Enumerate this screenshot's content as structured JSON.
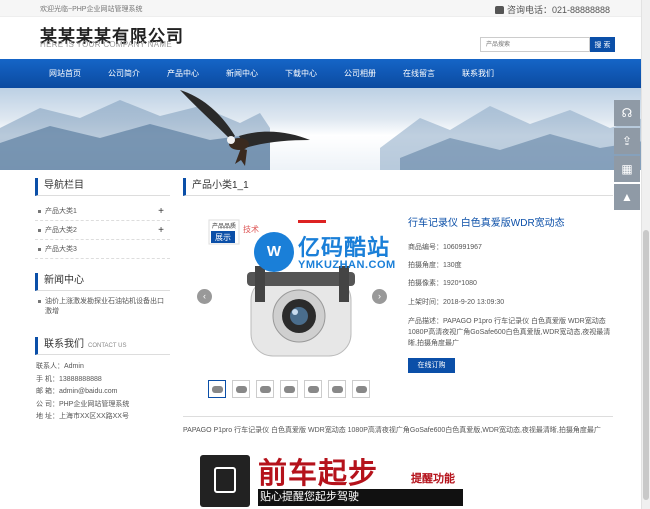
{
  "topbar": {
    "welcome": "欢迎光临~PHP企业网站管理系统",
    "phone": "咨询电话：021-88888888"
  },
  "header": {
    "company_cn": "某某某某有限公司",
    "company_en": "HERE IS YOUR COMPANY NAME",
    "search_placeholder": "产品搜索",
    "search_button": "搜 索"
  },
  "nav": {
    "items": [
      "网站首页",
      "公司简介",
      "产品中心",
      "新闻中心",
      "下载中心",
      "公司相册",
      "在线留言",
      "联系我们"
    ]
  },
  "sidebar": {
    "nav_title": "导航栏目",
    "categories": [
      {
        "label": "产品大类1",
        "expand": "+"
      },
      {
        "label": "产品大类2",
        "expand": "+"
      },
      {
        "label": "产品大类3",
        "expand": ""
      }
    ],
    "news_title": "新闻中心",
    "news": [
      "油价上涨激发勘探业石油钻机设备出口激增"
    ],
    "contact_title": "联系我们",
    "contact_sub": "CONTACT US",
    "contact": [
      "联系人：Admin",
      "手 机：13888888888",
      "邮 箱：admin@baidu.com",
      "公 司：PHP企业网站管理系统",
      "地 址：上海市XX区XX路XX号"
    ]
  },
  "main": {
    "title": "产品小类1_1",
    "product_title": "行车记录仪 白色真爱版WDR宽动态",
    "fields": [
      "商品编号：1060991967",
      "拍摄角度：130度",
      "拍摄像素：1920*1080",
      "上架时间：2018-9-20 13:09:30"
    ],
    "description": "产品描述：PAPAGO P1pro 行车记录仪 白色真爱版 WDR宽动态 1080P高清夜视广角GoSafe600白色真爱版,WDR宽动态,夜视最清晰,拍摄角度最广",
    "order_button": "在线订购",
    "detail": "PAPAGO P1pro 行车记录仪 白色真爱版 WDR宽动态 1080P高清夜视广角GoSafe600白色真爱版,WDR宽动态,夜视最清晰,拍摄角度最广",
    "gallery_prev": "‹",
    "gallery_next": "›",
    "image_labels": {
      "badge_top": "产品品质",
      "badge_main": "展示",
      "tech_mark": "技术"
    }
  },
  "watermark": {
    "cn": "亿码酷站",
    "en": "YMKUZHAN.COM"
  },
  "promo": {
    "headline": "前车起步",
    "sub": "提醒功能",
    "slogan": "贴心提醒您起步驾驶"
  },
  "side_tools": [
    "headset-icon",
    "share-icon",
    "qrcode-icon",
    "rocket-icon"
  ],
  "colors": {
    "brand_blue": "#0b4fa8",
    "nav_blue": "#1565c7",
    "promo_red": "#b5121b",
    "tool_gray": "#8f9aa6"
  }
}
